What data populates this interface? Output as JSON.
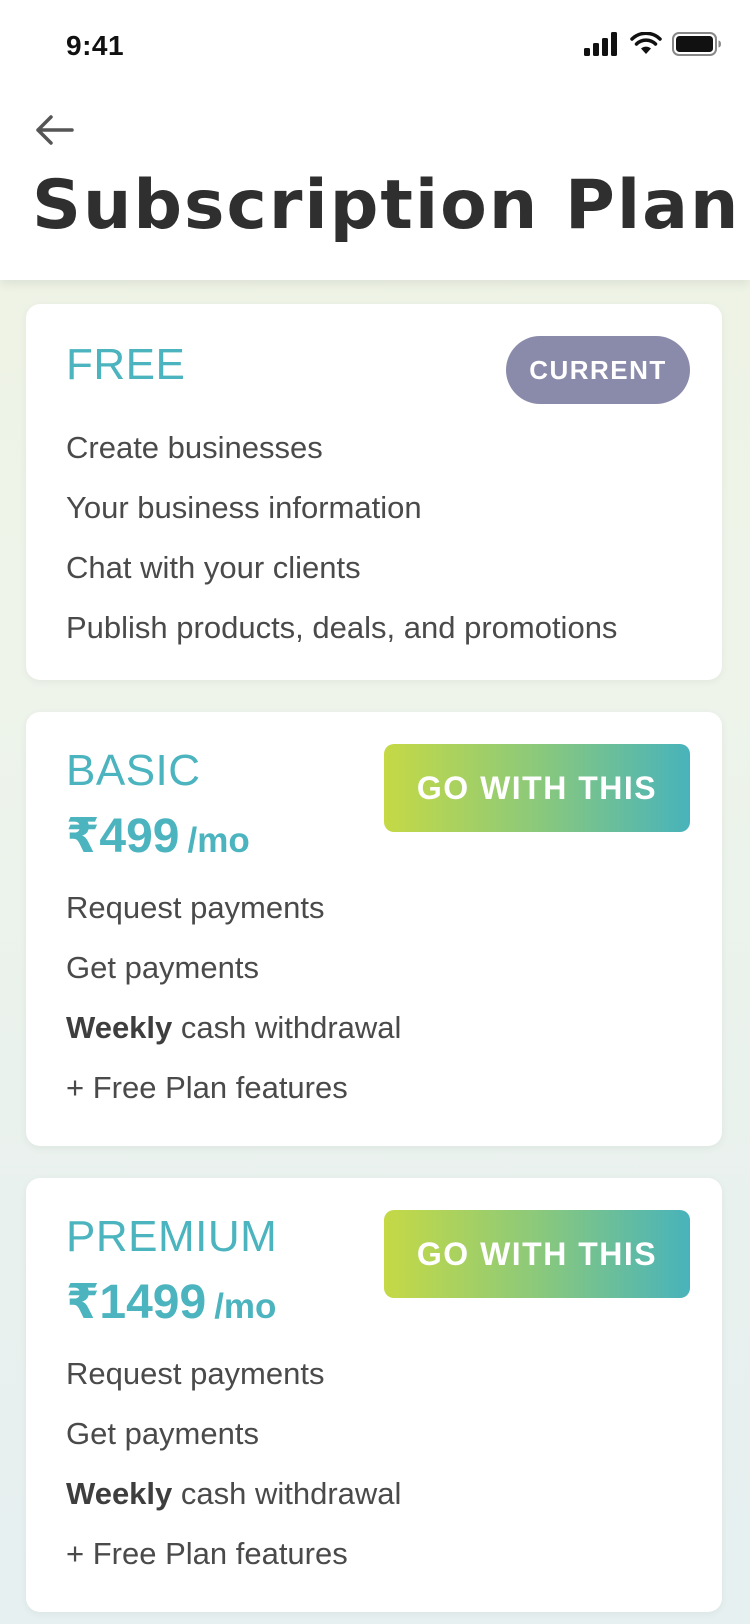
{
  "status_bar": {
    "time": "9:41",
    "icons": [
      "signal-icon",
      "wifi-icon",
      "battery-icon"
    ]
  },
  "header": {
    "back_icon": "arrow-left-icon",
    "title": "Subscription Plan"
  },
  "colors": {
    "accent": "#4bb4bf",
    "badge": "#8a8bab",
    "button_gradient": [
      "#c5d945",
      "#8bc97b",
      "#48b3bb"
    ],
    "text": "#4a4a4a"
  },
  "plans": [
    {
      "name": "FREE",
      "badge": "CURRENT",
      "features": [
        "Create businesses",
        "Your business information",
        "Chat with your clients",
        "Publish  products, deals, and promotions"
      ]
    },
    {
      "name": "BASIC",
      "price": "₹499",
      "unit": "/mo",
      "button": "GO WITH THIS",
      "features": [
        {
          "bold": "",
          "text": "Request payments"
        },
        {
          "bold": "",
          "text": "Get payments"
        },
        {
          "bold": "Weekly",
          "text": " cash withdrawal"
        },
        {
          "bold": "",
          "text": "+ Free Plan features"
        }
      ]
    },
    {
      "name": "PREMIUM",
      "price": "₹1499",
      "unit": "/mo",
      "button": "GO WITH THIS",
      "features": [
        {
          "bold": "",
          "text": "Request payments"
        },
        {
          "bold": "",
          "text": "Get payments"
        },
        {
          "bold": "Weekly",
          "text": " cash withdrawal"
        },
        {
          "bold": "",
          "text": "+ Free Plan features"
        }
      ]
    }
  ]
}
